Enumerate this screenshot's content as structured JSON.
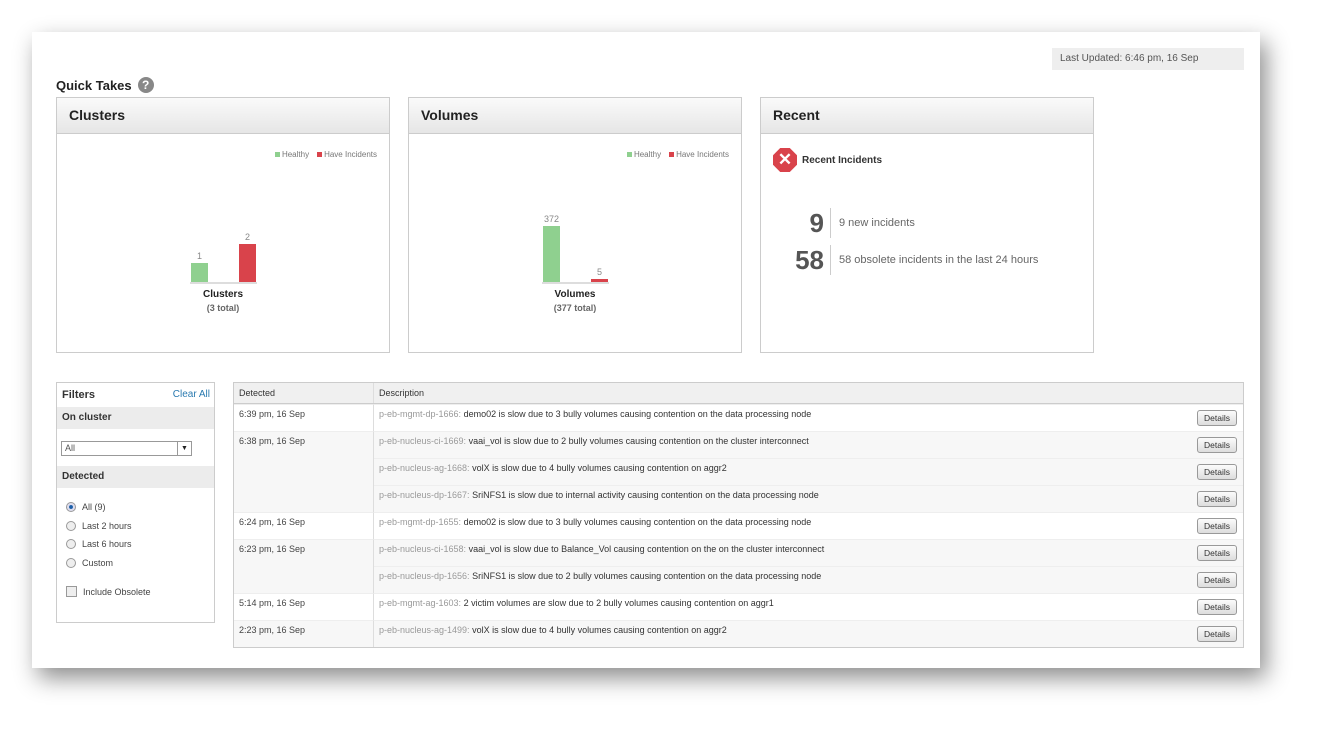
{
  "last_updated": "Last Updated: 6:46 pm, 16 Sep",
  "title": "Quick Takes",
  "colors": {
    "healthy": "#8fd08f",
    "incidents": "#d9434b"
  },
  "legend": {
    "healthy": "Healthy",
    "incidents": "Have Incidents"
  },
  "clusters": {
    "title": "Clusters",
    "caption": "Clusters",
    "total": "(3 total)",
    "healthy": 1,
    "incidents": 2
  },
  "volumes": {
    "title": "Volumes",
    "caption": "Volumes",
    "total": "(377 total)",
    "healthy": 372,
    "incidents": 5
  },
  "recent": {
    "title": "Recent",
    "heading": "Recent Incidents",
    "new_count": "9",
    "new_text": "9 new incidents",
    "obsolete_count": "58",
    "obsolete_text": "58 obsolete incidents in the last 24 hours"
  },
  "filters": {
    "title": "Filters",
    "clear": "Clear All",
    "on_cluster": "On cluster",
    "cluster_value": "All",
    "detected": "Detected",
    "options": [
      "All (9)",
      "Last 2 hours",
      "Last 6 hours",
      "Custom"
    ],
    "selected": 0,
    "include_obsolete": "Include Obsolete"
  },
  "table": {
    "headers": [
      "Detected",
      "Description"
    ],
    "details": "Details",
    "rows": [
      {
        "detected": "6:39 pm, 16 Sep",
        "src": "p-eb-mgmt-dp-1666:",
        "desc": "demo02 is slow due to 3 bully volumes causing contention on the data processing node"
      },
      {
        "detected": "6:38 pm, 16 Sep",
        "src": "p-eb-nucleus-ci-1669:",
        "desc": "vaai_vol is slow due to 2 bully volumes causing contention on the cluster interconnect"
      },
      {
        "detected": "",
        "src": "p-eb-nucleus-ag-1668:",
        "desc": "volX is slow due to 4 bully volumes causing contention on aggr2"
      },
      {
        "detected": "",
        "src": "p-eb-nucleus-dp-1667:",
        "desc": "SriNFS1 is slow due to internal activity causing contention on the data processing node"
      },
      {
        "detected": "6:24 pm, 16 Sep",
        "src": "p-eb-mgmt-dp-1655:",
        "desc": "demo02 is slow due to 3 bully volumes causing contention on the data processing node"
      },
      {
        "detected": "6:23 pm, 16 Sep",
        "src": "p-eb-nucleus-ci-1658:",
        "desc": "vaai_vol is slow due to Balance_Vol causing contention on the on the cluster interconnect"
      },
      {
        "detected": "",
        "src": "p-eb-nucleus-dp-1656:",
        "desc": "SriNFS1 is slow due to 2 bully volumes causing contention on the data processing node"
      },
      {
        "detected": "5:14 pm, 16 Sep",
        "src": "p-eb-mgmt-ag-1603:",
        "desc": "2 victim volumes are slow due to 2 bully volumes causing contention on aggr1"
      },
      {
        "detected": "2:23 pm, 16 Sep",
        "src": "p-eb-nucleus-ag-1499:",
        "desc": "volX is slow due to 4 bully volumes causing contention on aggr2"
      }
    ]
  }
}
